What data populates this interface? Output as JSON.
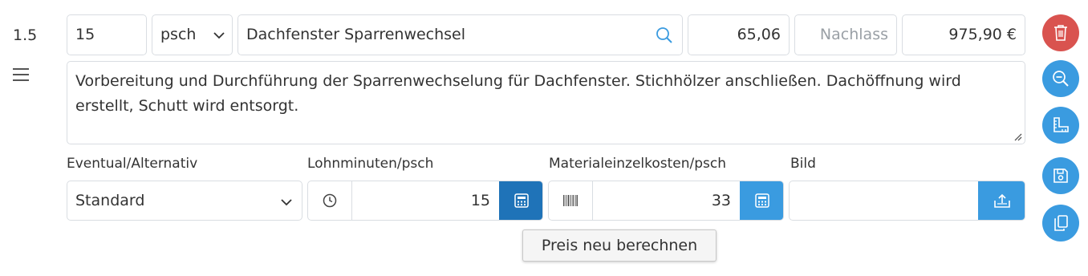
{
  "position": {
    "number": "1.5"
  },
  "item": {
    "quantity": "15",
    "unit": "psch",
    "title": "Dachfenster Sparrenwechsel",
    "unit_price": "65,06",
    "discount_placeholder": "Nachlass",
    "total": "975,90 €",
    "description": "Vorbereitung und Durchführung der Sparrenwechselung für Dachfenster. Stichhölzer anschließen. Dachöffnung wird erstellt, Schutt wird entsorgt."
  },
  "fields": {
    "eventual_label": "Eventual/Alternativ",
    "eventual_value": "Standard",
    "labor_label": "Lohnminuten/psch",
    "labor_value": "15",
    "material_label": "Materialeinzelkosten/psch",
    "material_value": "33",
    "image_label": "Bild"
  },
  "tooltip": {
    "text": "Preis neu berechnen"
  },
  "icons": {
    "delete": "trash-icon",
    "zoom": "zoom-out-icon",
    "measure": "ruler-icon",
    "save": "save-icon",
    "copy": "copy-icon"
  },
  "colors": {
    "primary": "#3a9be0",
    "danger": "#d9534f",
    "active": "#1f73b8"
  }
}
